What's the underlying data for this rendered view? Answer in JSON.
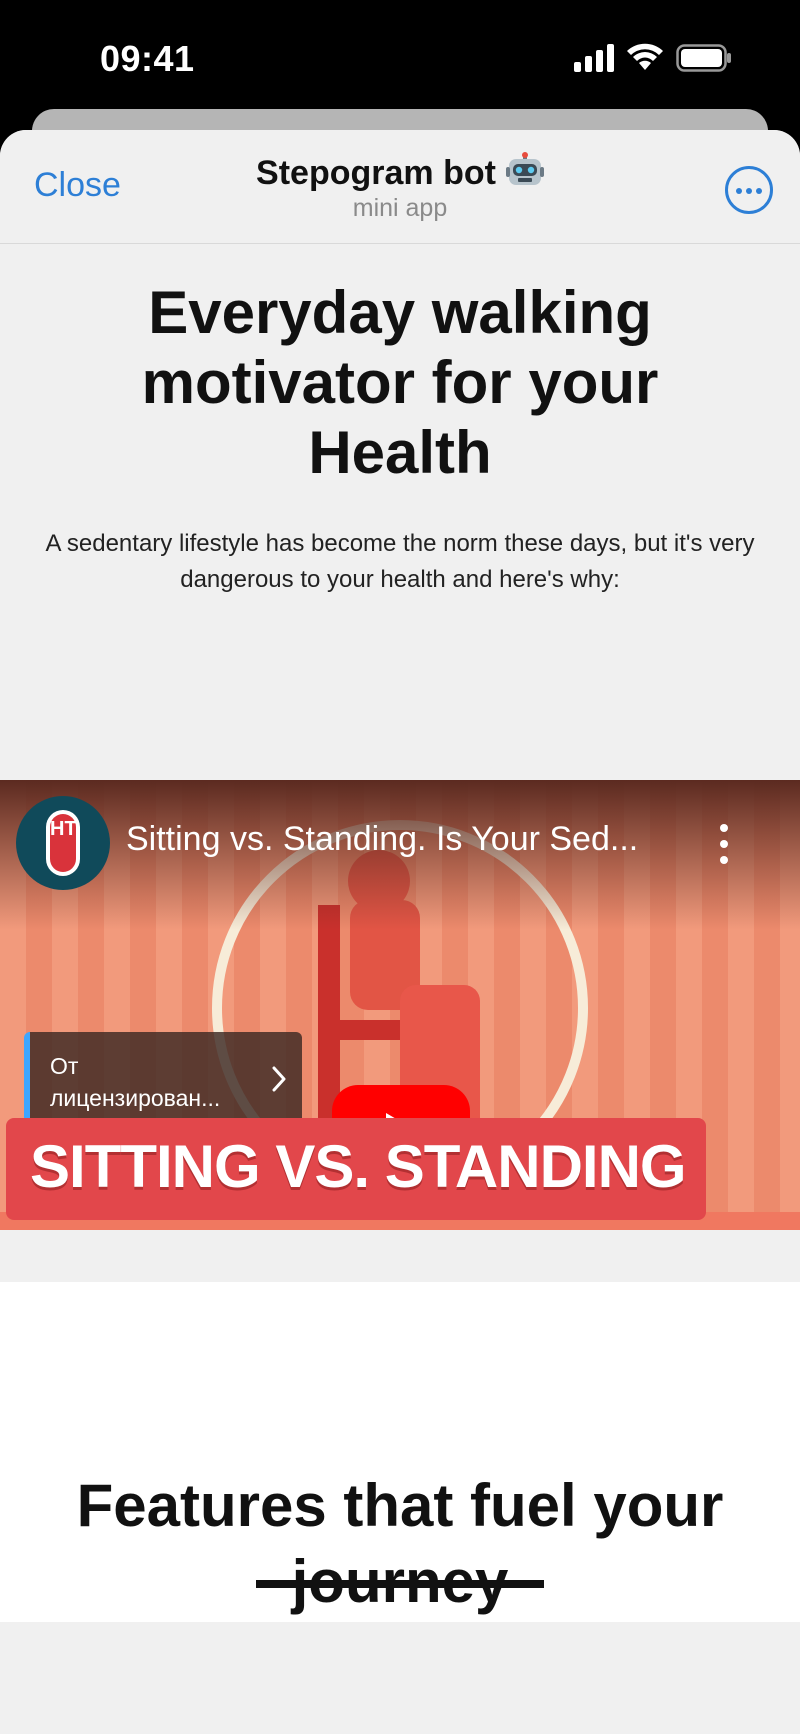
{
  "status_bar": {
    "time": "09:41",
    "icons": [
      "signal-icon",
      "wifi-icon",
      "battery-icon"
    ]
  },
  "header": {
    "close_label": "Close",
    "title": "Stepogram bot",
    "title_emoji": "robot-icon",
    "subtitle": "mini app",
    "more_icon": "more-circle-icon"
  },
  "hero": {
    "title": "Everyday walking motivator for your Health",
    "text": "A sedentary lifestyle has become the norm these days, but it's very dangerous to your health and here's why:"
  },
  "video": {
    "title": "Sitting vs. Standing. Is Your Sed...",
    "channel_initials": "HT",
    "license_label": "От лицензирован...",
    "banner_text": "SITTING VS. STANDING"
  },
  "features": {
    "title": "Features that fuel your journey"
  },
  "colors": {
    "accent": "#2d7fd6",
    "youtube_red": "#ff0000",
    "banner_red": "#e2474b",
    "sheet_bg": "#f0f0f0"
  }
}
